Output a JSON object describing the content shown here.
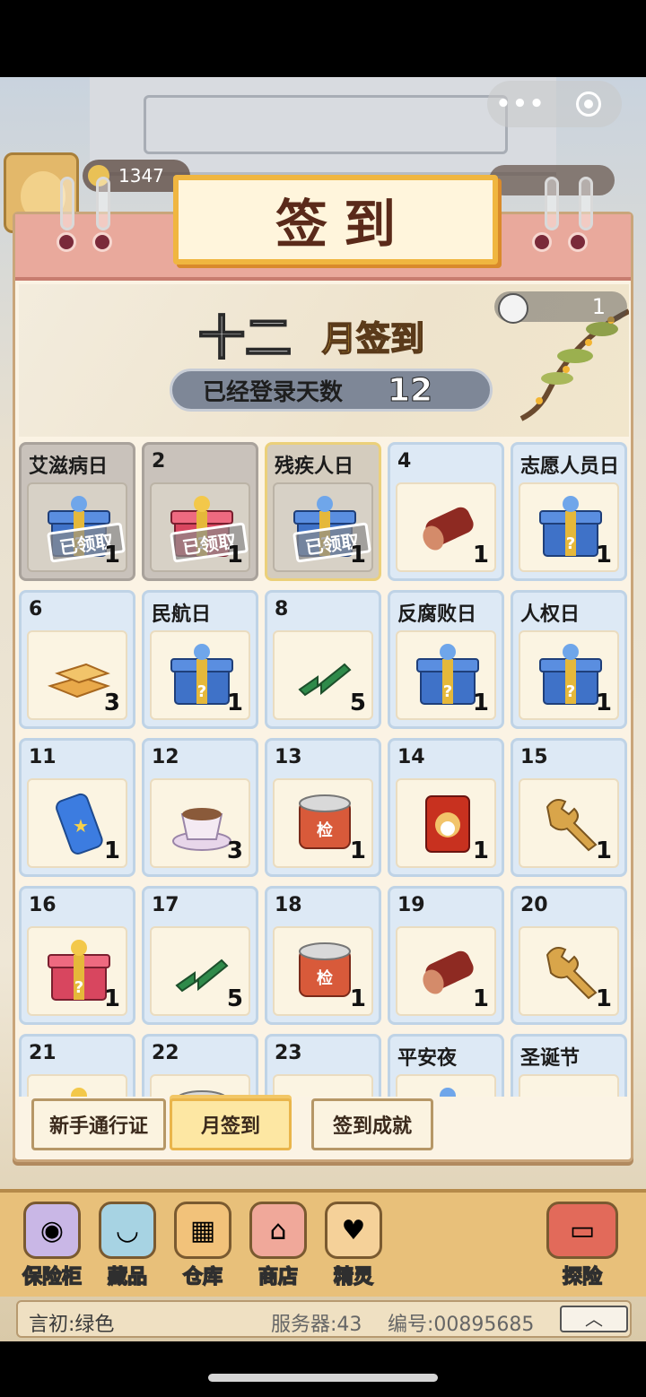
{
  "topbar": {
    "coins": "1347",
    "menu_glyph": "•••",
    "close_glyph": "◎"
  },
  "dialog": {
    "title": "签到",
    "month_title": "十二",
    "month_suffix": "月签到",
    "days_label": "已经登录天数",
    "days_value": "12",
    "token_count": "1"
  },
  "grid": [
    {
      "label": "艾滋病日",
      "qty": "1",
      "item": "chest-blue",
      "state": "claimed",
      "stamp": "已领取"
    },
    {
      "label": "2",
      "qty": "1",
      "item": "chest-red",
      "state": "claimed",
      "stamp": "已领取"
    },
    {
      "label": "残疾人日",
      "qty": "1",
      "item": "chest-blue",
      "state": "today",
      "stamp": "已领取"
    },
    {
      "label": "4",
      "qty": "1",
      "item": "wood-log",
      "state": "normal"
    },
    {
      "label": "志愿人员日",
      "qty": "1",
      "item": "chest-blue",
      "state": "normal"
    },
    {
      "label": "6",
      "qty": "3",
      "item": "gold-bars",
      "state": "normal"
    },
    {
      "label": "民航日",
      "qty": "1",
      "item": "chest-blue",
      "state": "normal"
    },
    {
      "label": "8",
      "qty": "5",
      "item": "green-gem",
      "state": "normal"
    },
    {
      "label": "反腐败日",
      "qty": "1",
      "item": "chest-blue",
      "state": "normal"
    },
    {
      "label": "人权日",
      "qty": "1",
      "item": "chest-blue",
      "state": "normal"
    },
    {
      "label": "11",
      "qty": "1",
      "item": "soda-can",
      "state": "normal"
    },
    {
      "label": "12",
      "qty": "3",
      "item": "coffee-cup",
      "state": "normal"
    },
    {
      "label": "13",
      "qty": "1",
      "item": "can",
      "state": "normal",
      "can_text": "检"
    },
    {
      "label": "14",
      "qty": "1",
      "item": "cat-can",
      "state": "normal"
    },
    {
      "label": "15",
      "qty": "1",
      "item": "wrench",
      "state": "normal"
    },
    {
      "label": "16",
      "qty": "1",
      "item": "chest-red",
      "state": "normal"
    },
    {
      "label": "17",
      "qty": "5",
      "item": "green-gem",
      "state": "normal"
    },
    {
      "label": "18",
      "qty": "1",
      "item": "can",
      "state": "normal",
      "can_text": "检"
    },
    {
      "label": "19",
      "qty": "1",
      "item": "wood-log",
      "state": "normal"
    },
    {
      "label": "20",
      "qty": "1",
      "item": "wrench",
      "state": "normal"
    },
    {
      "label": "21",
      "qty": "",
      "item": "chest-red",
      "state": "normal"
    },
    {
      "label": "22",
      "qty": "",
      "item": "can",
      "state": "normal"
    },
    {
      "label": "23",
      "qty": "",
      "item": "gold-bars",
      "state": "normal"
    },
    {
      "label": "平安夜",
      "qty": "",
      "item": "chest-blue",
      "state": "normal"
    },
    {
      "label": "圣诞节",
      "qty": "",
      "item": "wood-log",
      "state": "normal"
    }
  ],
  "tabs": [
    {
      "label": "新手通行证",
      "active": false
    },
    {
      "label": "月签到",
      "active": true
    },
    {
      "label": "签到成就",
      "active": false
    }
  ],
  "bottom_nav": [
    {
      "label": "保险柜",
      "icon": "safe-icon",
      "color": "#c9b7e6"
    },
    {
      "label": "藏品",
      "icon": "bowl-icon",
      "color": "#a7d3e3"
    },
    {
      "label": "仓库",
      "icon": "warehouse-icon",
      "color": "#f2c27a"
    },
    {
      "label": "商店",
      "icon": "shop-icon",
      "color": "#f0a89a"
    },
    {
      "label": "精灵",
      "icon": "fox-icon",
      "color": "#f5d199"
    }
  ],
  "explore": {
    "label": "探险",
    "icon": "bus-icon"
  },
  "status": {
    "name": "言初:绿色",
    "server": "服务器:43",
    "id": "编号:00895685",
    "up_glyph": "︿"
  }
}
